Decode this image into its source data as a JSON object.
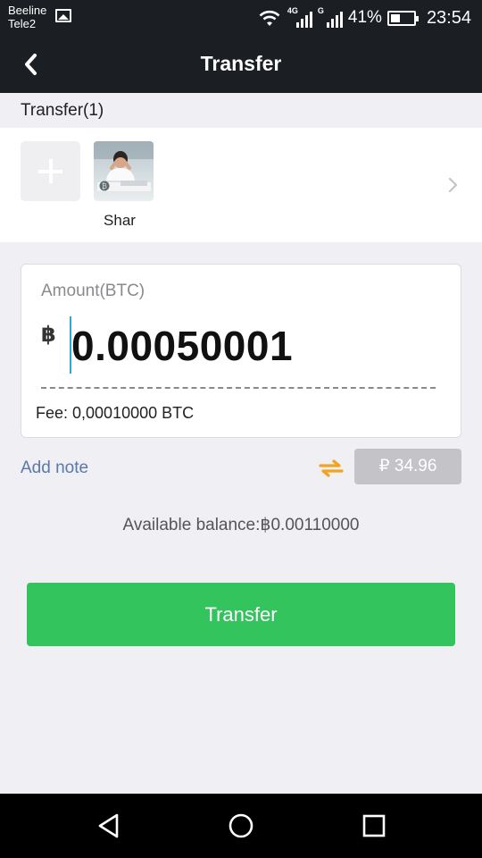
{
  "status_bar": {
    "carrier_1": "Beeline",
    "carrier_2": "Tele2",
    "net_type_1": "4G",
    "net_type_2": "G",
    "battery": "41%",
    "battery_level": 0.41,
    "time": "23:54"
  },
  "header": {
    "title": "Transfer",
    "back_icon": "chevron-left-icon"
  },
  "recipients": {
    "section_label": "Transfer(1)",
    "add_icon": "plus-icon",
    "contacts": [
      {
        "name": "Shar"
      }
    ],
    "more_icon": "chevron-right-icon"
  },
  "amount": {
    "label": "Amount(BTC)",
    "currency_symbol": "฿",
    "value": "0.00050001",
    "fee": "Fee: 0,00010000 BTC"
  },
  "note": {
    "add_note_label": "Add note",
    "swap_icon": "swap-arrows-icon",
    "fiat_value": "₽ 34.96"
  },
  "balance_text": "Available balance:฿0.00110000",
  "transfer_button": "Transfer",
  "colors": {
    "header_bg": "#1b1e23",
    "accent_green": "#33c45d",
    "link_blue": "#5a79a8",
    "swap_orange": "#f0a420"
  }
}
